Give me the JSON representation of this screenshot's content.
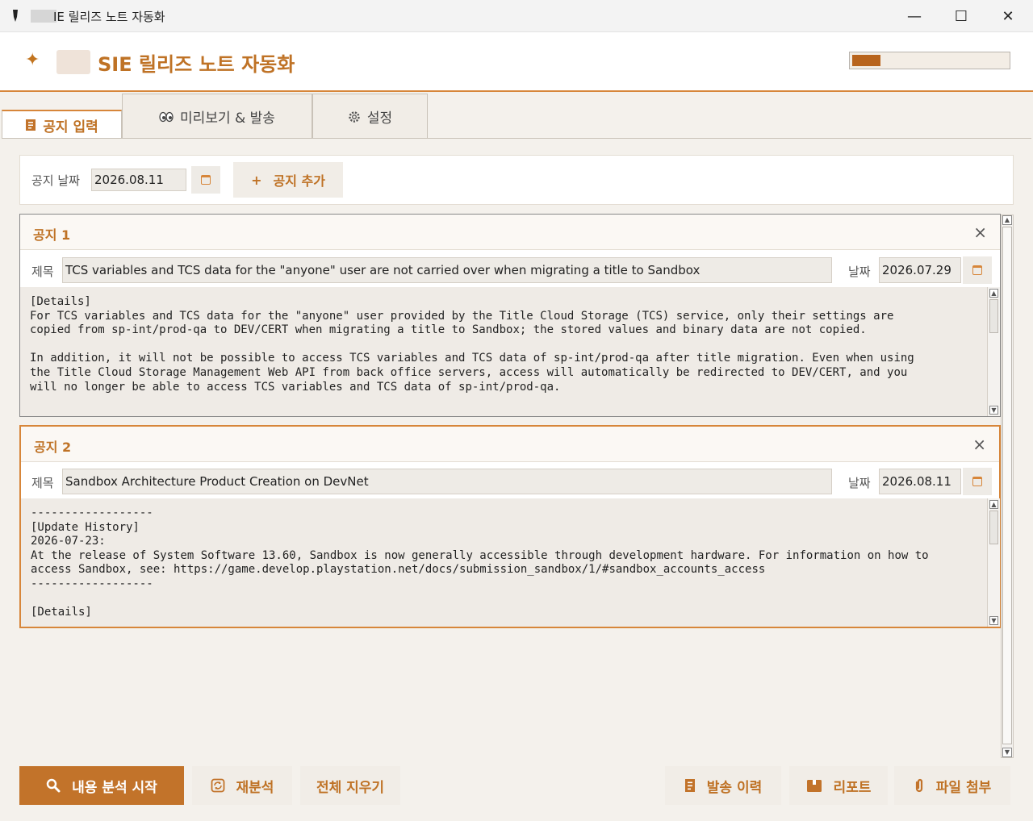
{
  "window": {
    "title": "IE 릴리즈 노트 자동화",
    "controls": {
      "minimize": "—",
      "maximize": "☐",
      "close": "✕"
    }
  },
  "header": {
    "logo_symbol": "✦",
    "title": "SIE 릴리즈 노트 자동화",
    "progress_fraction": 0.18
  },
  "tabs": [
    {
      "label": "공지 입력",
      "icon": "notebook-icon",
      "active": true
    },
    {
      "label": "미리보기 & 발송",
      "icon": "eyes-icon",
      "active": false
    },
    {
      "label": "설정",
      "icon": "gear-icon",
      "active": false
    }
  ],
  "datebar": {
    "label": "공지 날짜",
    "value": "2026.08.11",
    "add_label": "공지 추가",
    "add_symbol": "+"
  },
  "notices": [
    {
      "title": "공지 1",
      "subject_label": "제목",
      "subject": "TCS variables and TCS data for the \"anyone\" user are not carried over when migrating a title to Sandbox",
      "date_label": "날짜",
      "date": "2026.07.29",
      "body": "[Details]\nFor TCS variables and TCS data for the \"anyone\" user provided by the Title Cloud Storage (TCS) service, only their settings are\ncopied from sp-int/prod-qa to DEV/CERT when migrating a title to Sandbox; the stored values and binary data are not copied.\n\nIn addition, it will not be possible to access TCS variables and TCS data of sp-int/prod-qa after title migration. Even when using\nthe Title Cloud Storage Management Web API from back office servers, access will automatically be redirected to DEV/CERT, and you\nwill no longer be able to access TCS variables and TCS data of sp-int/prod-qa."
    },
    {
      "title": "공지 2",
      "subject_label": "제목",
      "subject": "Sandbox Architecture Product Creation on DevNet",
      "date_label": "날짜",
      "date": "2026.08.11",
      "body": "------------------\n[Update History]\n2026-07-23:\nAt the release of System Software 13.60, Sandbox is now generally accessible through development hardware. For information on how to\naccess Sandbox, see: https://game.develop.playstation.net/docs/submission_sandbox/1/#sandbox_accounts_access\n------------------\n\n[Details]"
    }
  ],
  "close_symbol": "×",
  "buttons": {
    "analyze": "내용 분석 시작",
    "reanalyze": "재분석",
    "clear_all": "전체 지우기",
    "send_history": "발송 이력",
    "report": "리포트",
    "attach_file": "파일 첨부"
  },
  "colors": {
    "accent": "#c2732a",
    "accent_text": "#bf7225",
    "background": "#f4f1ec"
  }
}
